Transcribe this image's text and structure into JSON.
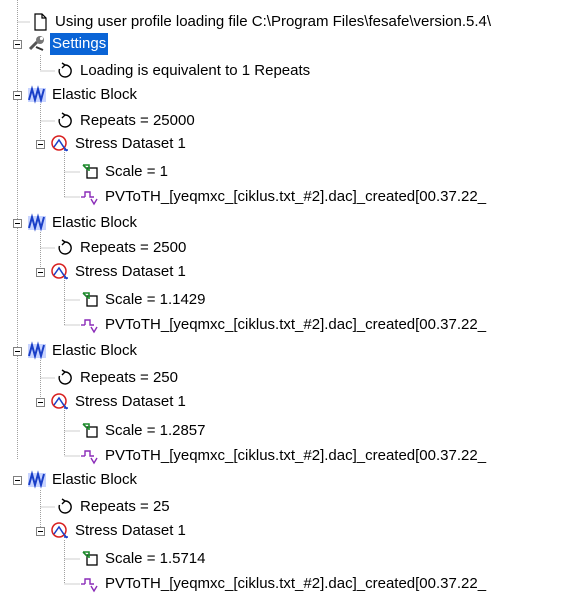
{
  "tree": {
    "root_file": "Using user profile loading file C:\\Program Files\\fesafe\\version.5.4\\",
    "settings": {
      "label": "Settings",
      "loading": "Loading is equivalent to 1 Repeats"
    },
    "blocks": [
      {
        "label": "Elastic Block",
        "repeats": "Repeats = 25000",
        "dataset": "Stress Dataset 1",
        "scale": "Scale = 1",
        "pvtoth": "PVToTH_[yeqmxc_[ciklus.txt_#2].dac]_created[00.37.22_"
      },
      {
        "label": "Elastic Block",
        "repeats": "Repeats = 2500",
        "dataset": "Stress Dataset 1",
        "scale": "Scale = 1.1429",
        "pvtoth": "PVToTH_[yeqmxc_[ciklus.txt_#2].dac]_created[00.37.22_"
      },
      {
        "label": "Elastic Block",
        "repeats": "Repeats = 250",
        "dataset": "Stress Dataset 1",
        "scale": "Scale = 1.2857",
        "pvtoth": "PVToTH_[yeqmxc_[ciklus.txt_#2].dac]_created[00.37.22_"
      },
      {
        "label": "Elastic Block",
        "repeats": "Repeats = 25",
        "dataset": "Stress Dataset 1",
        "scale": "Scale = 1.5714",
        "pvtoth": "PVToTH_[yeqmxc_[ciklus.txt_#2].dac]_created[00.37.22_"
      }
    ]
  },
  "icons": {
    "file": "file-icon",
    "settings": "wrench-settings-icon",
    "repeat": "repeat-cycle-icon",
    "block": "elastic-block-icon",
    "dataset": "stress-dataset-icon",
    "scale": "scale-icon",
    "pvtoth": "time-history-icon"
  },
  "colors": {
    "selection": "#0a64d6",
    "block_icon": "#1a3fc8",
    "dataset_icon": "#d81e1e",
    "scale_icon": "#1b8a2a",
    "pvtoth_icon": "#8a2bb8"
  }
}
